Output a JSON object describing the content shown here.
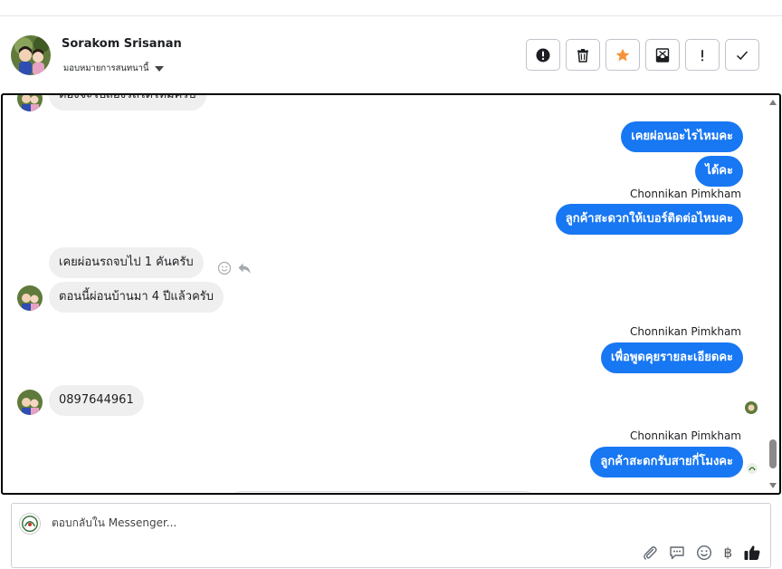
{
  "header": {
    "contact_name": "Sorakom Srisanan",
    "assign_label": "มอบหมายการสนทนานี้"
  },
  "actions": [
    {
      "name": "mark-spam-button",
      "icon": "alert-circle-icon"
    },
    {
      "name": "delete-button",
      "icon": "trash-icon"
    },
    {
      "name": "star-button",
      "icon": "star-icon",
      "color": "#f7923a"
    },
    {
      "name": "archive-button",
      "icon": "envelope-x-icon"
    },
    {
      "name": "follow-up-button",
      "icon": "exclamation-icon"
    },
    {
      "name": "mark-done-button",
      "icon": "check-icon"
    }
  ],
  "conversation": {
    "partial_top": "ต้องจะไปส่องรถได้ไหมครับ",
    "messages": [
      {
        "dir": "out",
        "text": "เคยผ่อนอะไรไหมคะ"
      },
      {
        "dir": "out",
        "text": "ได้คะ"
      },
      {
        "dir": "sender",
        "text": "Chonnikan Pimkham"
      },
      {
        "dir": "out",
        "text": "ลูกค้าสะดวกให้เบอร์ติดต่อไหมคะ"
      },
      {
        "dir": "in",
        "text": "เคยผ่อนรถจบไป 1 คันครับ"
      },
      {
        "dir": "in",
        "text": "ตอนนี้ผ่อนบ้านมา 4 ปีแล้วครับ"
      },
      {
        "dir": "sender",
        "text": "Chonnikan Pimkham"
      },
      {
        "dir": "out",
        "text": "เพื่อพูดคุยรายละเอียดคะ"
      },
      {
        "dir": "in",
        "text": "0897644961"
      },
      {
        "dir": "sender",
        "text": "Chonnikan Pimkham"
      },
      {
        "dir": "out",
        "text": "ลูกค้าสะดกรับสายกี่โมงคะ"
      }
    ]
  },
  "composer": {
    "placeholder": "ตอบกลับใน Messenger...",
    "tools": [
      "paperclip-icon",
      "chat-icon",
      "smiley-icon",
      "baht-icon",
      "thumbs-up-icon"
    ],
    "baht_symbol": "฿"
  },
  "colors": {
    "accent": "#1877f2",
    "incoming_bubble": "#efefef",
    "star": "#f7923a"
  }
}
